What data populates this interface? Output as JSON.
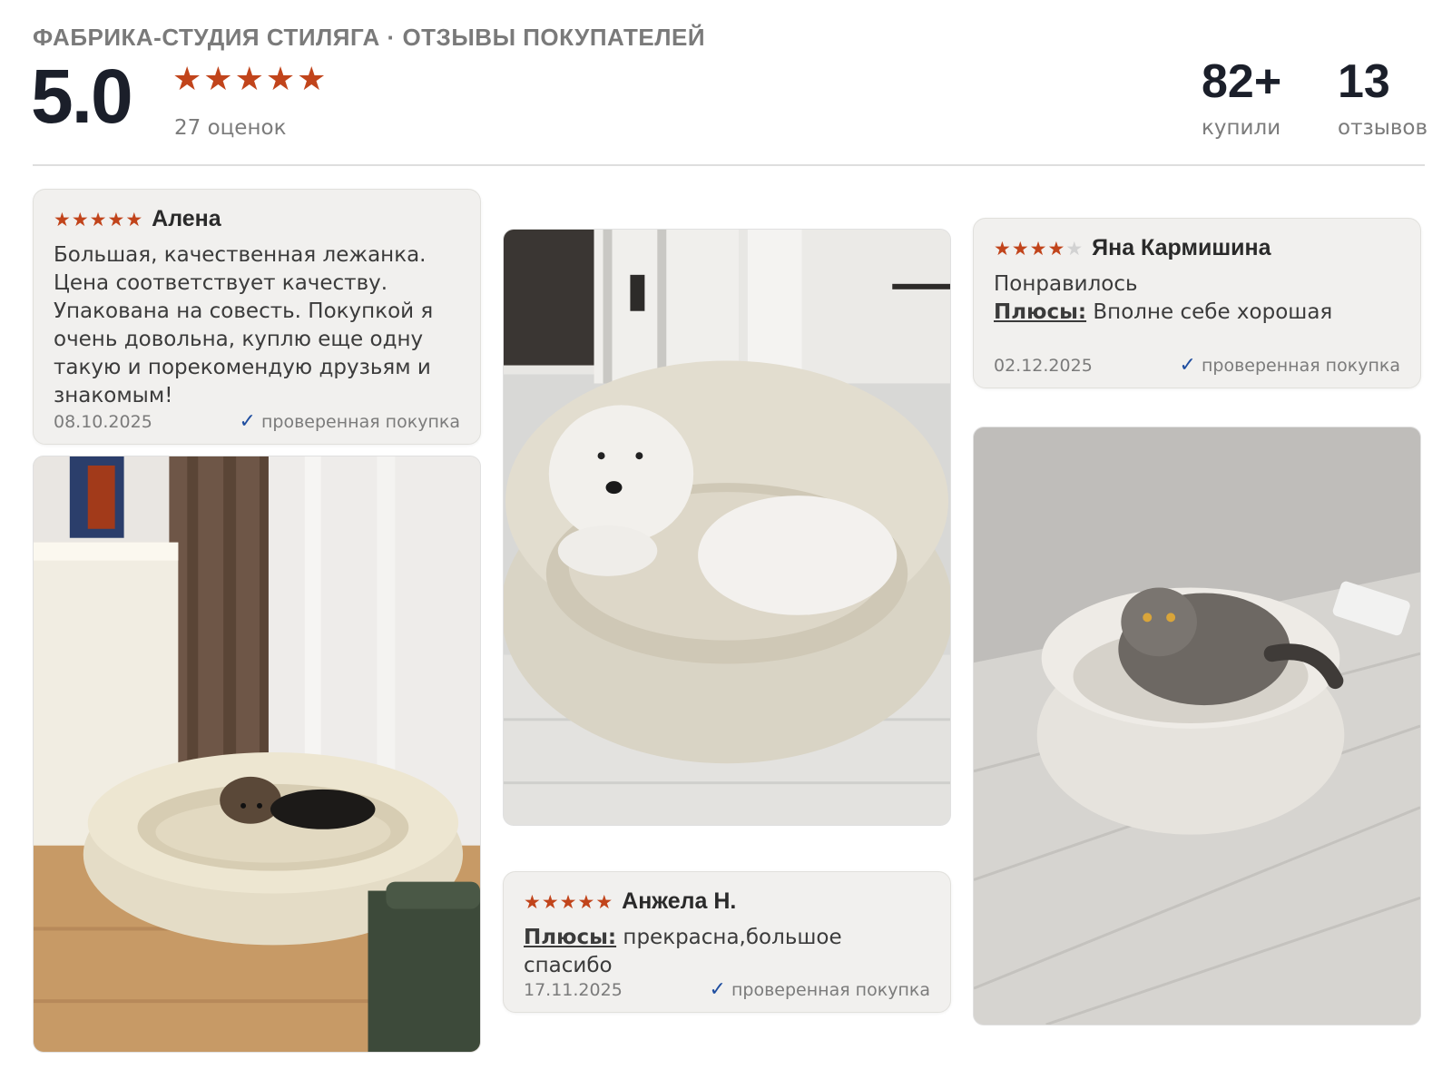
{
  "header": {
    "brand": "ФАБРИКА-СТУДИЯ СТИЛЯГА · ОТЗЫВЫ ПОКУПАТЕЛЕЙ",
    "score": "5.0",
    "rating_stars": 5,
    "ratings_count": "27 оценок",
    "bought_num": "82+",
    "bought_label": "купили",
    "reviews_num": "13",
    "reviews_label": "отзывов"
  },
  "reviews": [
    {
      "name": "Алена",
      "stars": 5,
      "text": "Большая, качественная лежанка. Цена соответствует качеству. Упакована на совесть. Покупкой я очень довольна, куплю еще одну такую и порекомендую друзьям и знакомым!",
      "date": "08.10.2025",
      "verified": "проверенная покупка"
    },
    {
      "name": "Яна Кармишина",
      "stars": 4,
      "text": "Понравилось",
      "pros_label": "Плюсы:",
      "pros": " Вполне себе хорошая",
      "date": "02.12.2025",
      "verified": "проверенная покупка"
    },
    {
      "name": "Анжела Н.",
      "stars": 5,
      "pros_label": "Плюсы:",
      "pros": " прекрасна,большое спасибо",
      "date": "17.11.2025",
      "verified": "проверенная покупка"
    }
  ],
  "icons": {
    "star": "star-icon",
    "check": "checkmark-icon"
  },
  "colors": {
    "star": "#c1441b",
    "check": "#1f4ea0"
  }
}
